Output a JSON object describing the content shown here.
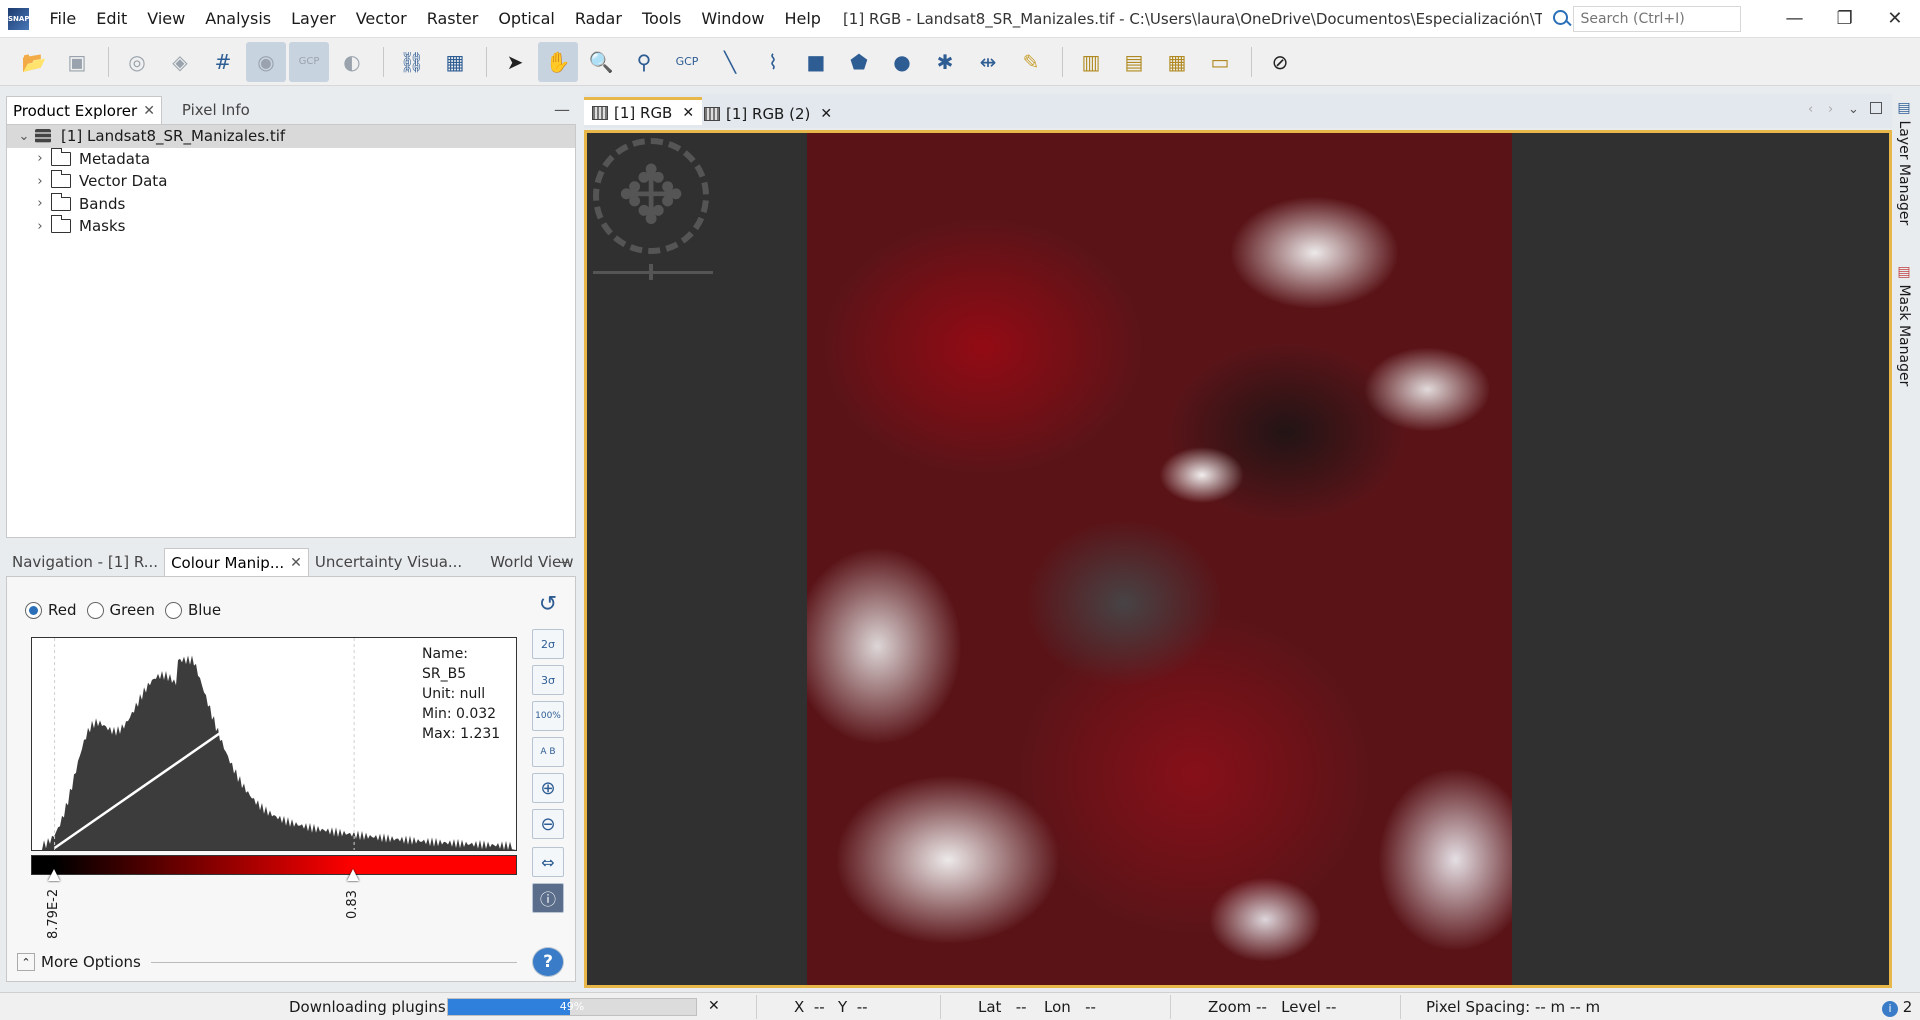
{
  "app": {
    "logo_text": "SNAP",
    "menu": [
      "File",
      "Edit",
      "View",
      "Analysis",
      "Layer",
      "Vector",
      "Raster",
      "Optical",
      "Radar",
      "Tools",
      "Window",
      "Help"
    ],
    "window_title": "[1] RGB - Landsat8_SR_Manizales.tif - C:\\Users\\laura\\OneDrive\\Documentos\\Especialización\\Teledetección\\clase_25...",
    "search_placeholder": "Search (Ctrl+I)"
  },
  "toolbar": {
    "gcp_label": "GCP"
  },
  "product_explorer": {
    "tabs": [
      {
        "label": "Product Explorer",
        "active": true
      },
      {
        "label": "Pixel Info",
        "active": false
      }
    ],
    "root": "[1] Landsat8_SR_Manizales.tif",
    "children": [
      "Metadata",
      "Vector Data",
      "Bands",
      "Masks"
    ]
  },
  "bottom_panel": {
    "tabs": [
      {
        "label": "Navigation - [1] R...",
        "active": false
      },
      {
        "label": "Colour Manip...",
        "active": true
      },
      {
        "label": "Uncertainty Visua...",
        "active": false
      },
      {
        "label": "World View",
        "active": false
      }
    ],
    "channels": [
      {
        "label": "Red",
        "selected": true
      },
      {
        "label": "Green",
        "selected": false
      },
      {
        "label": "Blue",
        "selected": false
      }
    ],
    "band_info": {
      "name": "Name: SR_B5",
      "unit": "Unit: null",
      "min": "Min: 0.032",
      "max": "Max: 1.231"
    },
    "slider_min_label": "8.79E-2",
    "slider_max_label": "0.83",
    "histogram": {
      "min": 0.032,
      "max": 1.231,
      "slider_min": 0.0879,
      "slider_max": 0.83
    },
    "side_buttons": [
      "2σ",
      "3σ",
      "100%",
      "A B"
    ],
    "more_options": "More Options"
  },
  "image_view": {
    "tabs": [
      {
        "label": "[1] RGB",
        "active": true
      },
      {
        "label": "[1] RGB (2)",
        "active": false
      }
    ],
    "colors": {
      "accent": "#e8b74a",
      "vegetation": "#b01020",
      "cloud": "#f2f2f2",
      "urban": "#4a4a4c"
    }
  },
  "side_tabs": [
    "Layer Manager",
    "Mask Manager"
  ],
  "status": {
    "task": "Downloading plugins...",
    "progress_percent": 49,
    "progress_label": "49%",
    "x_label": "X",
    "x_value": "--",
    "y_label": "Y",
    "y_value": "--",
    "lat_label": "Lat",
    "lat_value": "--",
    "lon_label": "Lon",
    "lon_value": "--",
    "zoom_label": "Zoom",
    "zoom_value": "--",
    "level_label": "Level",
    "level_value": "--",
    "pixel_spacing": "Pixel Spacing: -- m -- m",
    "notifications": "2"
  }
}
